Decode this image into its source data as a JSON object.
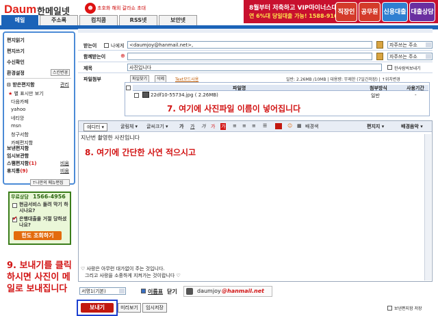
{
  "header": {
    "logo": "Daum",
    "service": "한메일넷",
    "promo": "초호화 해외 갈라쇼 초대",
    "banner_line1": "8월부터 저축하고 VIP마이너스대출",
    "banner_line2": "연 6%대 당일대출 가능! 1588-9166",
    "banner_buttons": [
      "직장인",
      "공무원",
      "신용대출",
      "대출상담"
    ]
  },
  "tabs": [
    "메일",
    "주소록",
    "컴치콤",
    "RSS넷",
    "보안넷"
  ],
  "sidebar": {
    "items": [
      "편지읽기",
      "편지쓰기",
      "수신확인",
      "환경설정"
    ],
    "settings_button": "스킨변경",
    "inbox_header": "받은편지함",
    "inbox_manage": "관리",
    "starred": "별 표시만 보기",
    "folders": [
      "다음카페",
      "yahoo",
      "네티앙",
      "msn",
      "청구서함",
      "카페편지함"
    ],
    "sent": "보낸편지함",
    "temp": "임시보관함",
    "spam": "스팸편지함",
    "spam_count": "(1)",
    "trash": "휴지통",
    "trash_count": "(9)",
    "empty_label": "비움",
    "menu_edit": "나만의 메뉴편집"
  },
  "ad": {
    "title": "무료상담",
    "phone": "1566-4956",
    "q1": "현금서비스 돌려 막기 하시나요?",
    "q2": "은행대출을 거절 당하셨나요?",
    "button": "한도 조회하기"
  },
  "instruction9": "9. 보내기를 클릭하시면 사진이 메일로 보내집니다",
  "form": {
    "to_label": "받는이",
    "to_me": "나에게",
    "to_value": "<daumjoy@hanmail.net>,",
    "cc_label": "함께받는이",
    "subject_label": "제목",
    "subject_value": "사진입니다",
    "attach_label": "파일첨부",
    "addr_select": "자주쓰는 주소",
    "hanja": "한사람씩보내기",
    "find_btn": "파일찾기",
    "delete_btn": "삭제",
    "textmode": "Text모드사용",
    "capacity": "일반: 2.26MB /10MB | 대용량: 무제한 (7일간저장) | ↑위치변경",
    "col_filename": "파일명",
    "col_method": "첨부방식",
    "col_period": "사용기간",
    "file_name": "22df10-55734.jpg ( 2.26MB)",
    "file_method": "일반",
    "file_period": "-"
  },
  "instruction7": "7. 여기에 사진파일 이름이 넣어집니다",
  "editor": {
    "toolbar": [
      "에디터 ▾",
      "굴림체 ▾",
      "글씨크기 ▾",
      "가",
      "가",
      "가",
      "가",
      "가",
      "배경색",
      "편지지 ▾",
      "배경음악 ▾"
    ],
    "body_line": "지난번 촬영한 사진입니다",
    "instruction8": "8. 여기에 간단한 사연 적으시고",
    "signature1": "♡ 사랑은 아무런 대가없이 주는 것입니다.",
    "signature2": "그리고 사랑을 소중하게 지켜가는 것이랍니다 ♡"
  },
  "bottom": {
    "sig_select": "서명1(기본)",
    "sig_check": "이름표",
    "sig_close": "닫기",
    "sig_email_user": "daumjoy",
    "sig_email_domain": "@hanmail.net",
    "send": "보내기",
    "preview": "미리보기",
    "save_temp": "임시저장",
    "save_sent": "보낸편지함 저장"
  },
  "colors": {
    "brand": "#1b63b8",
    "banner": "#c8102e",
    "instruction": "#d21414"
  }
}
